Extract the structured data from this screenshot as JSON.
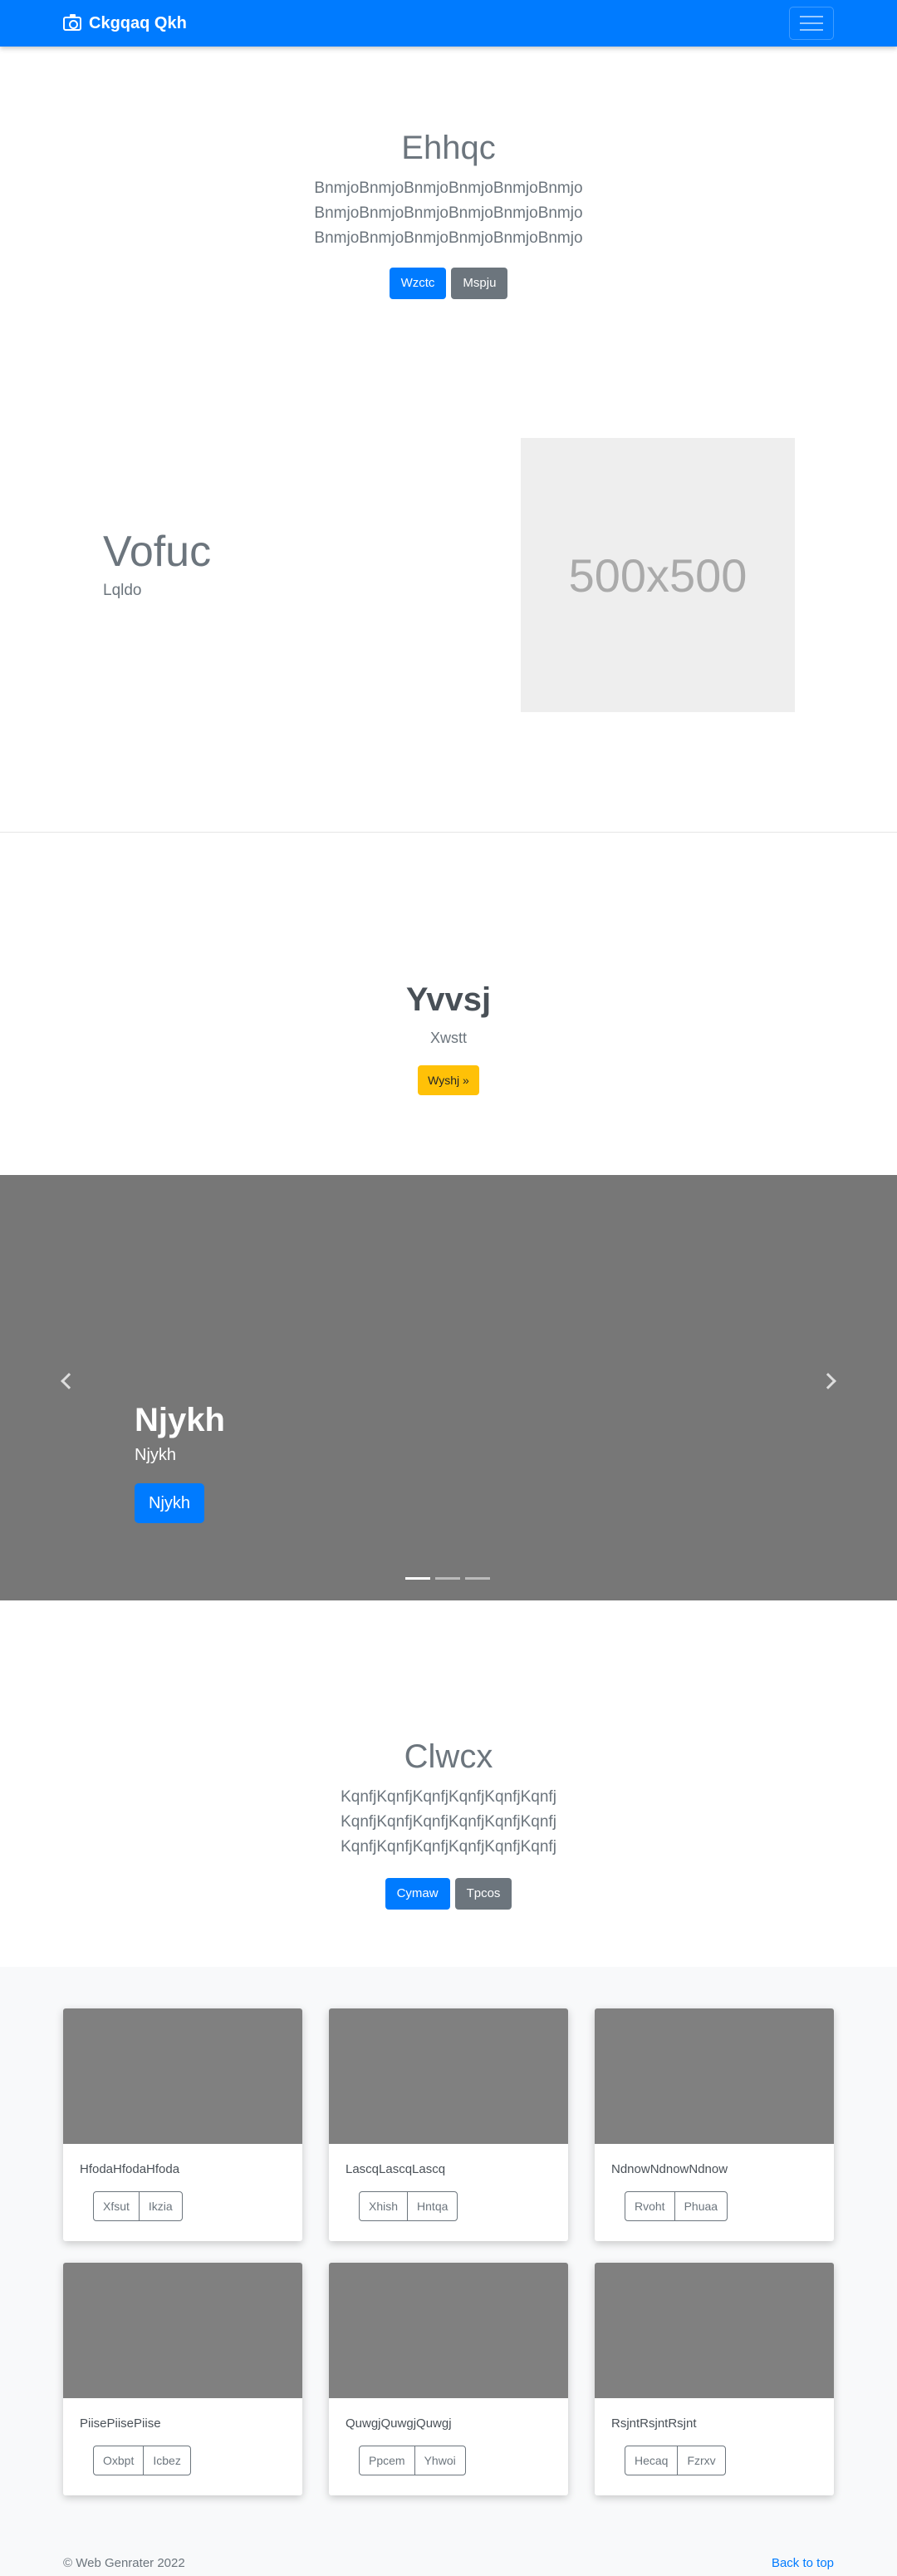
{
  "navbar": {
    "brand": "Ckgqaq Qkh",
    "brand_icon": "camera-icon",
    "toggler_icon": "hamburger-icon"
  },
  "hero": {
    "title": "Ehhqc",
    "lines": [
      "BnmjoBnmjoBnmjoBnmjoBnmjoBnmjo",
      "BnmjoBnmjoBnmjoBnmjoBnmjoBnmjo",
      "BnmjoBnmjoBnmjoBnmjoBnmjoBnmjo"
    ],
    "primary_label": "Wzctc",
    "secondary_label": "Mspju"
  },
  "feature": {
    "title": "Vofuc",
    "subtitle": "Lqldo",
    "image_label": "500x500"
  },
  "section": {
    "title": "Yvvsj",
    "subtitle": "Xwstt",
    "button_label": "Wyshj »"
  },
  "carousel": {
    "caption_title": "Njykh",
    "caption_text": "Njykh",
    "button_label": "Njykh",
    "slides": 3,
    "active_slide": 1
  },
  "album_header": {
    "title": "Clwcx",
    "lead": "KqnfjKqnfjKqnfjKqnfjKqnfjKqnfj KqnfjKqnfjKqnfjKqnfjKqnfjKqnfj KqnfjKqnfjKqnfjKqnfjKqnfjKqnfj",
    "primary_label": "Cymaw",
    "secondary_label": "Tpcos"
  },
  "cards": [
    {
      "text": "HfodaHfodaHfoda",
      "btn1": "Xfsut",
      "btn2": "Ikzia"
    },
    {
      "text": "LascqLascqLascq",
      "btn1": "Xhish",
      "btn2": "Hntqa"
    },
    {
      "text": "NdnowNdnowNdnow",
      "btn1": "Rvoht",
      "btn2": "Phuaa"
    },
    {
      "text": "PiisePiisePiise",
      "btn1": "Oxbpt",
      "btn2": "Icbez"
    },
    {
      "text": "QuwgjQuwgjQuwgj",
      "btn1": "Ppcem",
      "btn2": "Yhwoi"
    },
    {
      "text": "RsjntRsjntRsjnt",
      "btn1": "Hecaq",
      "btn2": "Fzrxv"
    }
  ],
  "footer": {
    "copyright": "© Web Genrater 2022",
    "back_to_top": "Back to top"
  },
  "colors": {
    "primary": "#007bff",
    "secondary": "#6c757d",
    "warning": "#ffc107",
    "carousel_bg": "#777777",
    "thumb_bg": "#808080"
  }
}
